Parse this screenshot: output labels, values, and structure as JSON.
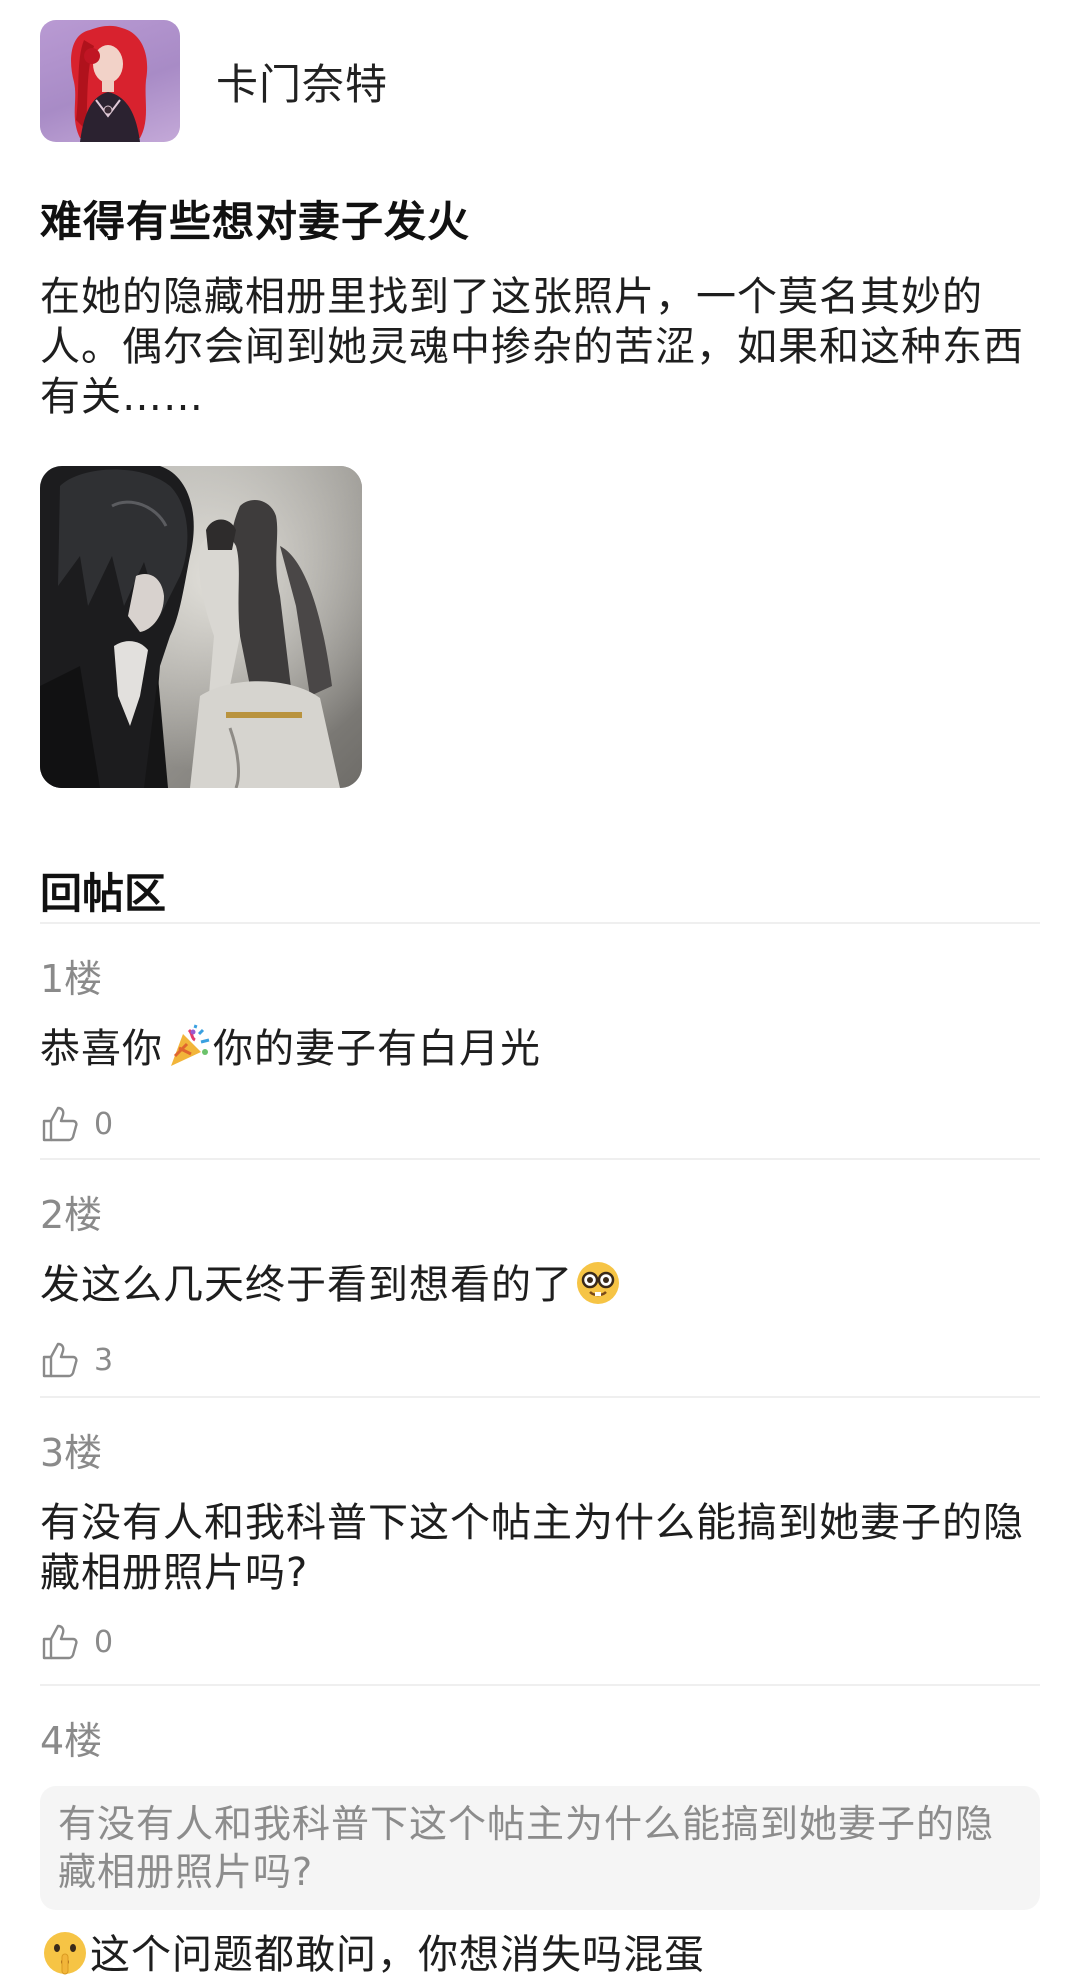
{
  "author": {
    "name": "卡门奈特",
    "avatar_icon": "character-avatar"
  },
  "post": {
    "title": "难得有些想对妻子发火",
    "body": "在她的隐藏相册里找到了这张照片，一个莫名其妙的人。偶尔会闻到她灵魂中掺杂的苦涩，如果和这种东西有关……",
    "image_icon": "anime-artwork-thumbnail"
  },
  "replies": {
    "section_title": "回帖区",
    "floors": [
      {
        "label": "1楼",
        "text_before": "恭喜你",
        "emoji": "party-popper-icon",
        "text_after": "你的妻子有白月光",
        "likes": "0"
      },
      {
        "label": "2楼",
        "text_before": "发这么几天终于看到想看的了",
        "emoji": "nerd-face-icon",
        "text_after": "",
        "likes": "3"
      },
      {
        "label": "3楼",
        "text": "有没有人和我科普下这个帖主为什么能搞到她妻子的隐藏相册照片吗?",
        "likes": "0"
      },
      {
        "label": "4楼",
        "quote": "有没有人和我科普下这个帖主为什么能搞到她妻子的隐藏相册照片吗?",
        "emoji": "shushing-face-icon",
        "text": "这个问题都敢问，你想消失吗混蛋"
      }
    ]
  },
  "colors": {
    "avatar_bg": "#b99ad3",
    "muted_text": "#8a8a8a",
    "divider": "#efefef",
    "quote_bg": "#f5f5f5"
  }
}
